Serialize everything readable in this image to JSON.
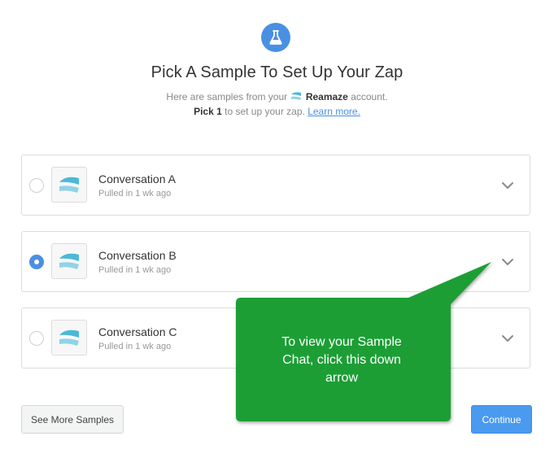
{
  "header": {
    "icon": "flask-icon",
    "accent_color": "#4a90e2",
    "title": "Pick A Sample To Set Up Your Zap",
    "subtitle_prefix": "Here are samples from your",
    "app_name": "Reamaze",
    "subtitle_suffix": "account.",
    "pick_count": "Pick 1",
    "pick_suffix": "to set up your zap.",
    "learn_more": "Learn more."
  },
  "samples": [
    {
      "name": "Conversation A",
      "meta": "Pulled in 1 wk ago",
      "selected": false
    },
    {
      "name": "Conversation B",
      "meta": "Pulled in 1 wk ago",
      "selected": true
    },
    {
      "name": "Conversation C",
      "meta": "Pulled in 1 wk ago",
      "selected": false
    }
  ],
  "buttons": {
    "see_more": "See More Samples",
    "continue": "Continue"
  },
  "callout": {
    "line1": "To view your Sample",
    "line2": "Chat, click this down",
    "line3": "arrow",
    "color": "#1f9e36"
  }
}
